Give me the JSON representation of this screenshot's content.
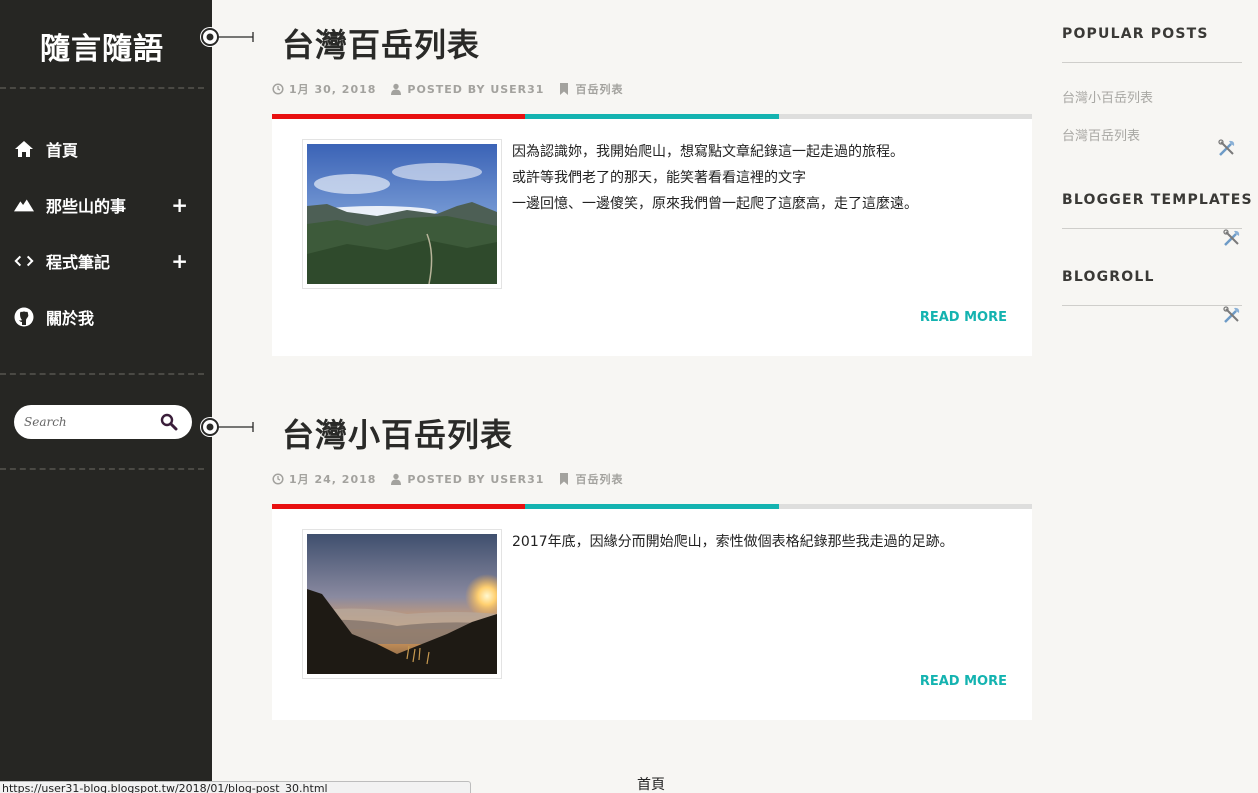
{
  "site": {
    "title": "隨言隨語"
  },
  "nav": {
    "items": [
      {
        "label": "首頁",
        "icon": "home-icon",
        "expandable": false
      },
      {
        "label": "那些山的事",
        "icon": "mountain-icon",
        "expandable": true,
        "expand_symbol": "+"
      },
      {
        "label": "程式筆記",
        "icon": "code-icon",
        "expandable": true,
        "expand_symbol": "+"
      },
      {
        "label": "關於我",
        "icon": "github-icon",
        "expandable": false
      }
    ]
  },
  "search": {
    "placeholder": "Search"
  },
  "posts": [
    {
      "title": "台灣百岳列表",
      "date": "1月 30, 2018",
      "author": "POSTED BY USER31",
      "label": "百岳列表",
      "excerpt": [
        "因為認識妳，我開始爬山，想寫點文章紀錄這一起走過的旅程。",
        "或許等我們老了的那天，能笑著看看這裡的文字",
        "一邊回憶、一邊傻笑，原來我們曾一起爬了這麼高，走了這麼遠。"
      ],
      "read_more": "READ MORE"
    },
    {
      "title": "台灣小百岳列表",
      "date": "1月 24, 2018",
      "author": "POSTED BY USER31",
      "label": "百岳列表",
      "excerpt": [
        "2017年底，因緣分而開始爬山，索性做個表格紀錄那些我走過的足跡。"
      ],
      "read_more": "READ MORE"
    }
  ],
  "widgets": {
    "popular": {
      "title": "POPULAR POSTS",
      "links": [
        "台灣小百岳列表",
        "台灣百岳列表"
      ]
    },
    "templates": {
      "title": "BLOGGER TEMPLATES"
    },
    "blogroll": {
      "title": "BLOGROLL"
    }
  },
  "footer": {
    "home_link": "首頁"
  },
  "status_bar": {
    "url": "https://user31-blog.blogspot.tw/2018/01/blog-post_30.html"
  },
  "colors": {
    "accent_red": "#e81010",
    "accent_teal": "#14b3b0",
    "sidebar_bg": "#262623",
    "page_bg": "#f7f6f3"
  }
}
